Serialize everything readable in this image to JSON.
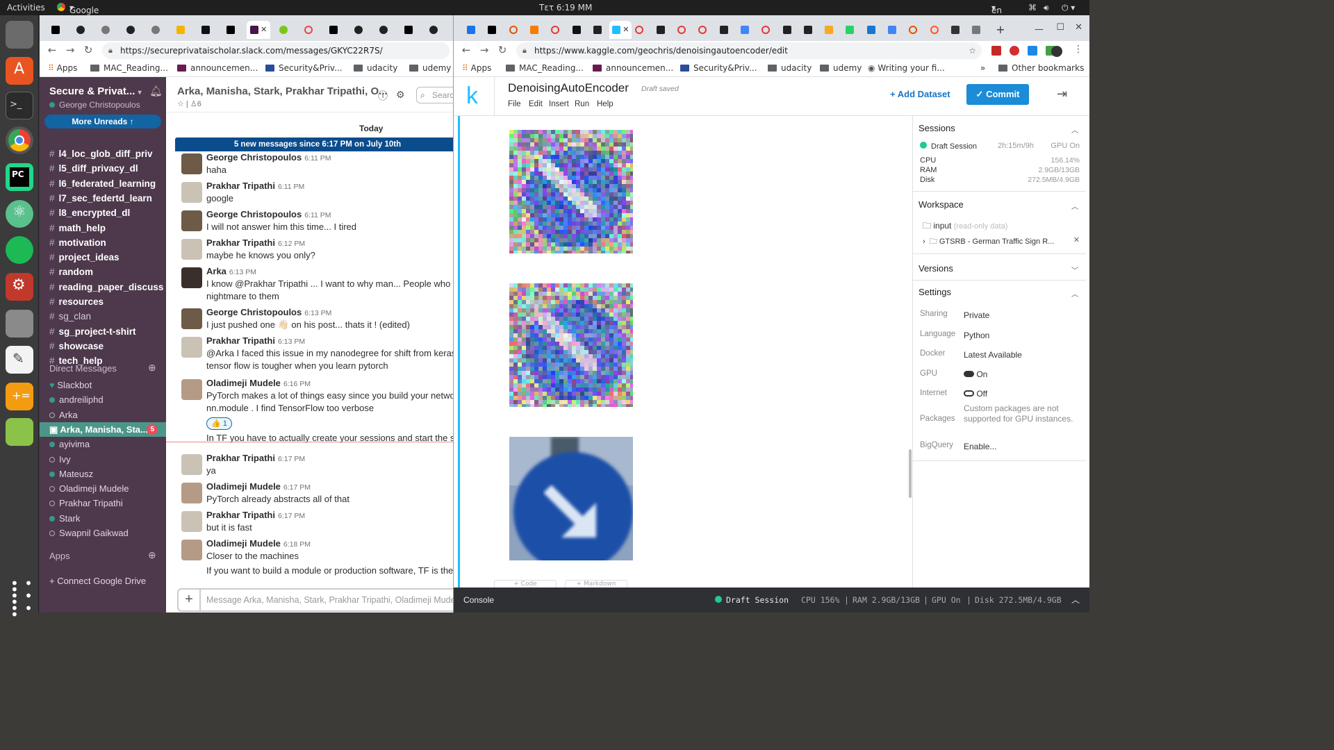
{
  "topbar": {
    "activities": "Activities",
    "app": "Google Chrome",
    "clock": "Τετ 6:19 ΜΜ",
    "lang": "en"
  },
  "dock": {
    "items": [
      "files-icon",
      "software-center-icon",
      "terminal-icon",
      "chrome-icon",
      "pycharm-icon",
      "atom-icon",
      "spotify-icon",
      "settings-icon",
      "disk-icon",
      "text-editor-icon",
      "calculator-icon",
      "image-viewer-icon",
      "apps-grid-icon"
    ]
  },
  "slack_window": {
    "url": "https://secureprivataischolar.slack.com/messages/GKYC22R7S/",
    "bookmarks": [
      "Apps",
      "MAC_Reading...",
      "announcemen...",
      "Security&Priv...",
      "udacity",
      "udemy"
    ],
    "workspace": {
      "name": "Secure & Privat...",
      "user": "George Christopoulos",
      "more_unreads": "More Unreads"
    },
    "channels": [
      {
        "name": "l4_loc_glob_diff_priv",
        "bold": true
      },
      {
        "name": "l5_diff_privacy_dl",
        "bold": true
      },
      {
        "name": "l6_federated_learning",
        "bold": true
      },
      {
        "name": "l7_sec_federtd_learn",
        "bold": true
      },
      {
        "name": "l8_encrypted_dl",
        "bold": true
      },
      {
        "name": "math_help",
        "bold": true
      },
      {
        "name": "motivation",
        "bold": true
      },
      {
        "name": "project_ideas",
        "bold": true
      },
      {
        "name": "random",
        "bold": true
      },
      {
        "name": "reading_paper_discuss",
        "bold": true
      },
      {
        "name": "resources",
        "bold": true
      },
      {
        "name": "sg_clan",
        "bold": false
      },
      {
        "name": "sg_project-t-shirt",
        "bold": true
      },
      {
        "name": "showcase",
        "bold": true
      },
      {
        "name": "tech_help",
        "bold": true
      }
    ],
    "dm_header": "Direct Messages",
    "dms": [
      {
        "name": "Slackbot",
        "status": "heart"
      },
      {
        "name": "andreiliphd",
        "status": "on"
      },
      {
        "name": "Arka",
        "status": "off"
      },
      {
        "name": "Arka, Manisha, Sta...",
        "status": "group",
        "badge": "5"
      },
      {
        "name": "ayivima",
        "status": "on"
      },
      {
        "name": "Ivy",
        "status": "off"
      },
      {
        "name": "Mateusz",
        "status": "on"
      },
      {
        "name": "Oladimeji Mudele",
        "status": "off"
      },
      {
        "name": "Prakhar Tripathi",
        "status": "off"
      },
      {
        "name": "Stark",
        "status": "on"
      },
      {
        "name": "Swapnil Gaikwad",
        "status": "off"
      }
    ],
    "apps_header": "Apps",
    "connect_drive": "+ Connect Google Drive",
    "channel_title": "Arka, Manisha, Stark, Prakhar Tripathi, O...",
    "member_count": "6",
    "search_placeholder": "Search",
    "day_divider": "Today",
    "new_banner": "5 new messages since 6:17 PM on July 10th",
    "messages": [
      {
        "name": "George Christopoulos",
        "time": "6:11 PM",
        "text": "haha",
        "text2": ""
      },
      {
        "name": "Prakhar Tripathi",
        "time": "6:11 PM",
        "text": "google",
        "text2": ""
      },
      {
        "name": "George Christopoulos",
        "time": "6:11 PM",
        "text": "I will not answer him this time... I tired",
        "text2": ""
      },
      {
        "name": "Prakhar Tripathi",
        "time": "6:12 PM",
        "text": "maybe he knows you only?",
        "text2": ""
      },
      {
        "name": "Arka",
        "time": "6:13 PM",
        "text": "I know @Prakhar Tripathi ... I want to why man... People who starte",
        "text2": "nightmare to them"
      },
      {
        "name": "George Christopoulos",
        "time": "6:13 PM",
        "text": "I just pushed one 👋🏻 on his post... thats it ! (edited)",
        "text2": ""
      },
      {
        "name": "Prakhar Tripathi",
        "time": "6:13 PM",
        "text": "@Arka I faced this issue in my nanodegree for shift from keras to t",
        "text2": "tensor flow is tougher when you learn pytorch"
      },
      {
        "name": "Oladimeji Mudele",
        "time": "6:16 PM",
        "text": "PyTorch makes a lot of things easy since you build your network us",
        "text2": "nn.module . I find TensorFlow too verbose"
      },
      {
        "name": "",
        "time": "",
        "text": "In TF you have to actually create your sessions and start the sessio",
        "text2": ""
      },
      {
        "name": "Prakhar Tripathi",
        "time": "6:17 PM",
        "text": "ya",
        "text2": ""
      },
      {
        "name": "Oladimeji Mudele",
        "time": "6:17 PM",
        "text": "PyTorch already abstracts all of that",
        "text2": ""
      },
      {
        "name": "Prakhar Tripathi",
        "time": "6:17 PM",
        "text": "but it is fast",
        "text2": ""
      },
      {
        "name": "Oladimeji Mudele",
        "time": "6:18 PM",
        "text": "Closer to the machines",
        "text2": ""
      },
      {
        "name": "",
        "time": "",
        "text": "If you want to build a module or production software, TF is the bes",
        "text2": ""
      }
    ],
    "reaction": "👍 1",
    "composer_placeholder": "Message Arka, Manisha, Stark, Prakhar Tripathi, Oladimeji Mudele"
  },
  "kaggle_window": {
    "url": "https://www.kaggle.com/geochris/denoisingautoencoder/edit",
    "bookmarks": [
      "Apps",
      "MAC_Reading...",
      "announcemen...",
      "Security&Priv...",
      "udacity",
      "udemy",
      "Writing your fi...",
      "»",
      "Other bookmarks"
    ],
    "logo": "k",
    "title": "DenoisingAutoEncoder",
    "save_state": "Draft saved",
    "menu": [
      "File",
      "Edit",
      "Insert",
      "Run",
      "Help"
    ],
    "add_dataset": "Add Dataset",
    "commit": "Commit",
    "add_code": "+ Code",
    "add_markdown": "+ Markdown",
    "sessions": {
      "header": "Sessions",
      "name": "Draft Session",
      "time": "2h:15m/9h",
      "gpu": "GPU On",
      "cpu_label": "CPU",
      "cpu": "156.14%",
      "ram_label": "RAM",
      "ram": "2.9GB/13GB",
      "disk_label": "Disk",
      "disk": "272.5MB/4.9GB"
    },
    "workspace": {
      "header": "Workspace",
      "input": "input",
      "input_note": "(read-only data)",
      "dataset": "GTSRB - German Traffic Sign R..."
    },
    "versions": {
      "header": "Versions"
    },
    "settings": {
      "header": "Settings",
      "sharing_label": "Sharing",
      "sharing": "Private",
      "language_label": "Language",
      "language": "Python",
      "docker_label": "Docker",
      "docker": "Latest Available",
      "gpu_label": "GPU",
      "gpu": "On",
      "internet_label": "Internet",
      "internet": "Off",
      "packages_label": "Packages",
      "packages": "Custom packages are not supported for GPU instances.",
      "bigquery_label": "BigQuery",
      "bigquery": "Enable..."
    },
    "console": {
      "label": "Console",
      "session": "Draft Session",
      "cpu": "CPU 156%",
      "ram": "RAM 2.9GB/13GB",
      "gpu": "GPU On",
      "disk": "Disk 272.5MB/4.9GB"
    }
  }
}
